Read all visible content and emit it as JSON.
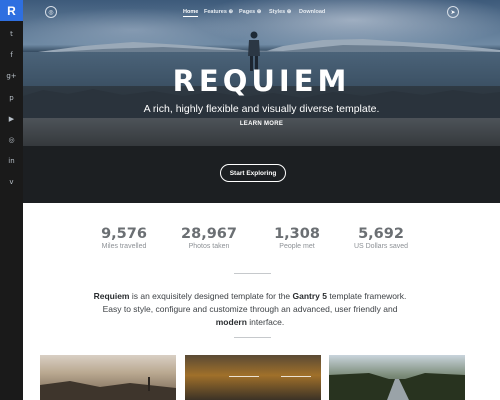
{
  "sidebar": {
    "logo": "R",
    "social_icons": [
      {
        "icon": "twitter-icon",
        "glyph": "t"
      },
      {
        "icon": "facebook-icon",
        "glyph": "f"
      },
      {
        "icon": "google-plus-icon",
        "glyph": "g+"
      },
      {
        "icon": "pinterest-icon",
        "glyph": "p"
      },
      {
        "icon": "youtube-icon",
        "glyph": "▶"
      },
      {
        "icon": "instagram-icon",
        "glyph": "◎"
      },
      {
        "icon": "linkedin-icon",
        "glyph": "in"
      },
      {
        "icon": "vimeo-icon",
        "glyph": "v"
      }
    ]
  },
  "nav": {
    "items": [
      "Home",
      "Features ⊕",
      "Pages ⊕",
      "Styles ⊕",
      "Download"
    ],
    "active": "Home"
  },
  "hero": {
    "title": "REQUIEM",
    "subtitle": "A rich, highly flexible and visually diverse template.",
    "learn_more": "LEARN MORE",
    "cta": "Start Exploring"
  },
  "stats": [
    {
      "value": "9,576",
      "label": "Miles travelled"
    },
    {
      "value": "28,967",
      "label": "Photos taken"
    },
    {
      "value": "1,308",
      "label": "People met"
    },
    {
      "value": "5,692",
      "label": "US Dollars saved"
    }
  ],
  "intro": {
    "brand": "Requiem",
    "text1": " is an exquisitely designed template for the ",
    "framework": "Gantry 5",
    "text2": " template framework. Easy to style, configure and customize through an advanced, user friendly and ",
    "modern": "modern",
    "text3": " interface."
  },
  "colors": {
    "brand": "#2e6fe0",
    "sidebar": "#1a1a1a",
    "stat_number": "#6b6f73"
  }
}
